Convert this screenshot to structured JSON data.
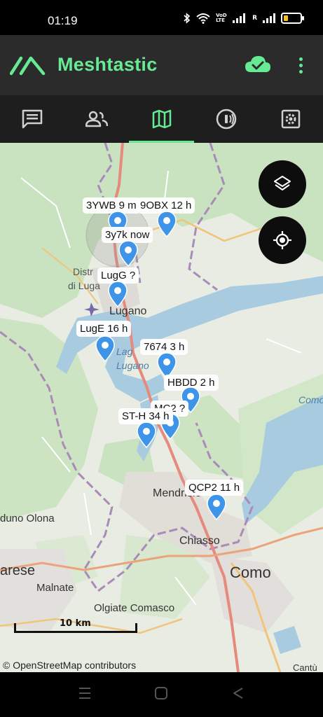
{
  "status_bar": {
    "time": "01:19",
    "icons": [
      "bluetooth-icon",
      "wifi-icon",
      "volte-icon",
      "signal-icon",
      "signal-roaming-icon",
      "battery-icon"
    ],
    "volte_text": "VoD LTE",
    "roaming_text": "R",
    "battery_level": 0.25
  },
  "app_bar": {
    "title": "Meshtastic",
    "accent_color": "#67ea94",
    "cloud_status_icon": "cloud-check-icon",
    "menu_icon": "more-vert-icon"
  },
  "tabs": [
    {
      "name": "messages",
      "icon": "message-icon",
      "active": false
    },
    {
      "name": "nodes",
      "icon": "people-icon",
      "active": false
    },
    {
      "name": "map",
      "icon": "map-icon",
      "active": true
    },
    {
      "name": "channels",
      "icon": "radio-icon",
      "active": false
    },
    {
      "name": "settings",
      "icon": "settings-icon",
      "active": false
    }
  ],
  "map": {
    "places": {
      "distretto_line1": "Distr",
      "distretto_line2": "di Luga",
      "lugano": "Lugano",
      "lago_line1": "Lag",
      "lago_line2": "Lugano",
      "mendrisio": "Mendrisio",
      "chiasso": "Chiasso",
      "como": "Como",
      "olona": "duno Olona",
      "arese": "arese",
      "malnate": "Malnate",
      "olgiate": "Olgiate Comasco",
      "como_right": "Como",
      "cantu": "Cantù"
    },
    "markers": [
      {
        "label": "3YWB 9 m"
      },
      {
        "label": "9OBX 12 h"
      },
      {
        "label": "3y7k now"
      },
      {
        "label": "LugG ?"
      },
      {
        "label": "LugE 16 h"
      },
      {
        "label": "7674 3 h"
      },
      {
        "label": "HBDD 2 h"
      },
      {
        "label": "MC2 ?"
      },
      {
        "label": "ST-H 34 h"
      },
      {
        "label": "QCP2 11 h"
      }
    ],
    "marker_color": "#3d94e8",
    "scale_label": "10 km",
    "attribution": "© OpenStreetMap contributors",
    "layers_button_icon": "layers-icon",
    "locate_button_icon": "my-location-icon"
  },
  "nav_bar": {
    "buttons": [
      "recent-apps-icon",
      "home-icon",
      "back-icon"
    ]
  }
}
